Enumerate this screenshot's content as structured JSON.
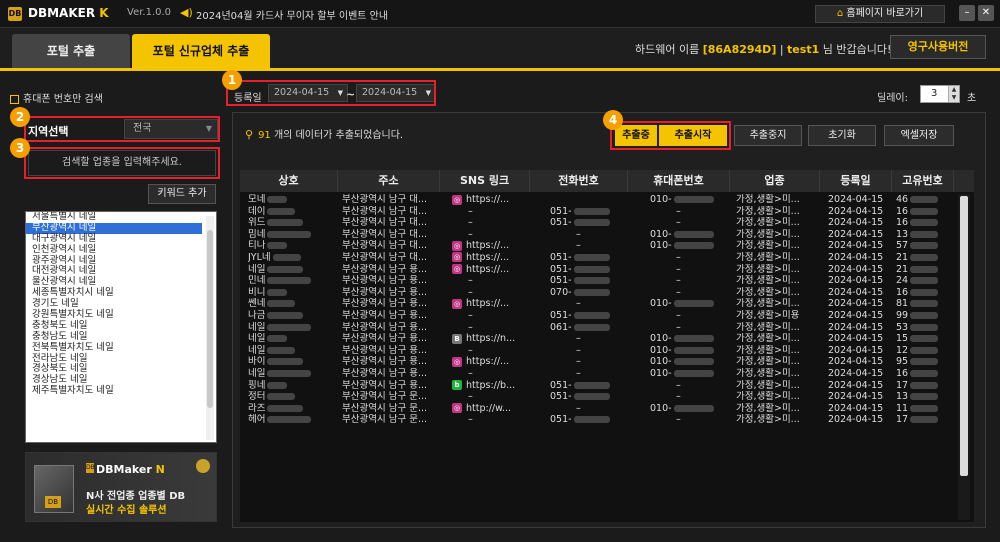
{
  "titlebar": {
    "logo": "DB",
    "app_name": "DBMAKER",
    "app_k": " K",
    "version": "Ver.1.0.0",
    "notice": "2024년04월 카드사 무이자 할부 이벤트 안내",
    "home_label": "홈페이지 바로가기",
    "min_label": "–",
    "close_label": "✕"
  },
  "tabs": {
    "tab1": "포털 추출",
    "tab2": "포털 신규업체 추출"
  },
  "hardware": {
    "prefix": "하드웨어 이름 ",
    "id": "[86A8294D]",
    "sep": " | ",
    "user": "test1",
    "suffix": " 님 반갑습니다!",
    "perm_label": "영구사용버전"
  },
  "left": {
    "mobile_only": "휴대폰 번호만 검색",
    "region_label": "지역선택",
    "region_value": "전국",
    "keyword_placeholder": "검색할 업종을 입력해주세요.",
    "keyword_add": "키워드 추가",
    "regions": [
      "서울특별시 네일",
      "부산광역시 네일",
      "대구광역시 네일",
      "인천광역시 네일",
      "광주광역시 네일",
      "대전광역시 네일",
      "울산광역시 네일",
      "세종특별자치시 네일",
      "경기도 네일",
      "강원특별자치도 네일",
      "충청북도 네일",
      "충청남도 네일",
      "전북특별자치도 네일",
      "전라남도 네일",
      "경상북도 네일",
      "경상남도 네일",
      "제주특별자치도 네일"
    ],
    "ad": {
      "brand_a": "DBMaker",
      "brand_b": " N",
      "line1": "N사 전업종 업종별 DB",
      "line2": "실시간 수집 솔루션"
    }
  },
  "badges": [
    "1",
    "2",
    "3",
    "4"
  ],
  "dates": {
    "label": "등록일",
    "from": "2024-04-15",
    "to": "2024-04-15",
    "tilde": "~"
  },
  "delay": {
    "label": "딜레이:",
    "value": "3",
    "unit": "초"
  },
  "status": {
    "count": "91",
    "text": " 개의 데이터가 추출되었습니다."
  },
  "buttons": {
    "extracting": "추출중",
    "start": "추출시작",
    "stop": "추출중지",
    "reset": "초기화",
    "excel": "엑셀저장"
  },
  "table": {
    "headers": [
      "상호",
      "주소",
      "SNS 링크",
      "전화번호",
      "휴대폰번호",
      "업종",
      "등록일",
      "고유번호"
    ],
    "rows": [
      {
        "name": "모네",
        "addr": "부산광역시 남구 대...",
        "sns": "https://...",
        "sns_type": "insta",
        "tel": "",
        "mobile": "010-",
        "cat": "가정,생활>미...",
        "date": "2024-04-15",
        "id": "46"
      },
      {
        "name": "데이",
        "addr": "부산광역시 남구 대...",
        "sns": "–",
        "sns_type": "",
        "tel": "051-",
        "mobile": "–",
        "cat": "가정,생활>미...",
        "date": "2024-04-15",
        "id": "16"
      },
      {
        "name": "위드",
        "addr": "부산광역시 남구 대...",
        "sns": "–",
        "sns_type": "",
        "tel": "051-",
        "mobile": "–",
        "cat": "가정,생활>미...",
        "date": "2024-04-15",
        "id": "16"
      },
      {
        "name": "밈네",
        "addr": "부산광역시 남구 대...",
        "sns": "–",
        "sns_type": "",
        "tel": "–",
        "mobile": "010-",
        "cat": "가정,생활>미...",
        "date": "2024-04-15",
        "id": "13"
      },
      {
        "name": "티나",
        "addr": "부산광역시 남구 대...",
        "sns": "https://...",
        "sns_type": "insta",
        "tel": "–",
        "mobile": "010-",
        "cat": "가정,생활>미...",
        "date": "2024-04-15",
        "id": "57"
      },
      {
        "name": "JYL네",
        "addr": "부산광역시 남구 대...",
        "sns": "https://...",
        "sns_type": "insta",
        "tel": "051-",
        "mobile": "–",
        "cat": "가정,생활>미...",
        "date": "2024-04-15",
        "id": "21"
      },
      {
        "name": "네일",
        "addr": "부산광역시 남구 용...",
        "sns": "https://...",
        "sns_type": "insta",
        "tel": "051-",
        "mobile": "–",
        "cat": "가정,생활>미...",
        "date": "2024-04-15",
        "id": "21"
      },
      {
        "name": "민네",
        "addr": "부산광역시 남구 용...",
        "sns": "–",
        "sns_type": "",
        "tel": "051-",
        "mobile": "–",
        "cat": "가정,생활>미...",
        "date": "2024-04-15",
        "id": "24"
      },
      {
        "name": "비니",
        "addr": "부산광역시 남구 용...",
        "sns": "–",
        "sns_type": "",
        "tel": "070-",
        "mobile": "–",
        "cat": "가정,생활>미...",
        "date": "2024-04-15",
        "id": "16"
      },
      {
        "name": "쎈네",
        "addr": "부산광역시 남구 용...",
        "sns": "https://...",
        "sns_type": "insta",
        "tel": "–",
        "mobile": "010-",
        "cat": "가정,생활>미...",
        "date": "2024-04-15",
        "id": "81"
      },
      {
        "name": "나금",
        "addr": "부산광역시 남구 용...",
        "sns": "–",
        "sns_type": "",
        "tel": "051-",
        "mobile": "–",
        "cat": "가정,생활>미용",
        "date": "2024-04-15",
        "id": "99"
      },
      {
        "name": "네일",
        "addr": "부산광역시 남구 용...",
        "sns": "–",
        "sns_type": "",
        "tel": "061-",
        "mobile": "–",
        "cat": "가정,생활>미...",
        "date": "2024-04-15",
        "id": "53"
      },
      {
        "name": "네일",
        "addr": "부산광역시 남구 용...",
        "sns": "https://n...",
        "sns_type": "blog",
        "tel": "–",
        "mobile": "010-",
        "cat": "가정,생활>미...",
        "date": "2024-04-15",
        "id": "15"
      },
      {
        "name": "네일",
        "addr": "부산광역시 남구 용...",
        "sns": "–",
        "sns_type": "",
        "tel": "–",
        "mobile": "010-",
        "cat": "가정,생활>미...",
        "date": "2024-04-15",
        "id": "12"
      },
      {
        "name": "바이",
        "addr": "부산광역시 남구 용...",
        "sns": "https://...",
        "sns_type": "insta",
        "tel": "–",
        "mobile": "010-",
        "cat": "가정,생활>미...",
        "date": "2024-04-15",
        "id": "95"
      },
      {
        "name": "네일",
        "addr": "부산광역시 남구 용...",
        "sns": "–",
        "sns_type": "",
        "tel": "–",
        "mobile": "010-",
        "cat": "가정,생활>미...",
        "date": "2024-04-15",
        "id": "16"
      },
      {
        "name": "핑네",
        "addr": "부산광역시 남구 용...",
        "sns": "https://b...",
        "sns_type": "band",
        "tel": "051-",
        "mobile": "–",
        "cat": "가정,생활>미...",
        "date": "2024-04-15",
        "id": "17"
      },
      {
        "name": "정터",
        "addr": "부산광역시 남구 문...",
        "sns": "–",
        "sns_type": "",
        "tel": "051-",
        "mobile": "–",
        "cat": "가정,생활>미...",
        "date": "2024-04-15",
        "id": "13"
      },
      {
        "name": "라즈",
        "addr": "부산광역시 남구 문...",
        "sns": "http://w...",
        "sns_type": "insta",
        "tel": "–",
        "mobile": "010-",
        "cat": "가정,생활>미...",
        "date": "2024-04-15",
        "id": "11"
      },
      {
        "name": "헤어",
        "addr": "부산광역시 남구 문...",
        "sns": "–",
        "sns_type": "",
        "tel": "051-",
        "mobile": "–",
        "cat": "가정,생활>미...",
        "date": "2024-04-15",
        "id": "17"
      }
    ]
  },
  "colors": {
    "accent": "#f5c400",
    "highlight_box": "#e8202a",
    "badge": "#f5a000",
    "insta": "#c13584",
    "blog": "#777777",
    "band": "#1fb53a"
  }
}
